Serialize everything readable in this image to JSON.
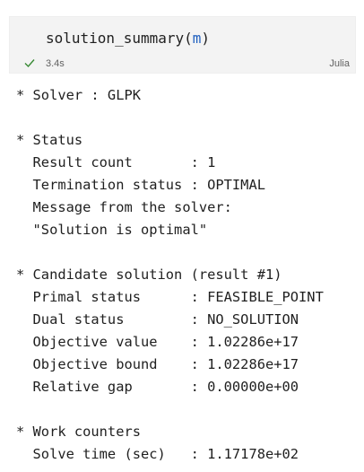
{
  "cell": {
    "code_fn": "solution_summary",
    "code_open": "(",
    "code_arg": "m",
    "code_close": ")",
    "status_icon": "check-icon",
    "elapsed": "3.4s",
    "language": "Julia"
  },
  "output": {
    "lines": [
      "* Solver : GLPK",
      "",
      "* Status",
      "  Result count       : 1",
      "  Termination status : OPTIMAL",
      "  Message from the solver:",
      "  \"Solution is optimal\"",
      "",
      "* Candidate solution (result #1)",
      "  Primal status      : FEASIBLE_POINT",
      "  Dual status        : NO_SOLUTION",
      "  Objective value    : 1.02286e+17",
      "  Objective bound    : 1.02286e+17",
      "  Relative gap       : 0.00000e+00",
      "",
      "* Work counters",
      "  Solve time (sec)   : 1.17178e+02"
    ]
  },
  "colors": {
    "cell_bg": "#f3f3f3",
    "success": "#388a34",
    "arg": "#1f5fbf"
  }
}
